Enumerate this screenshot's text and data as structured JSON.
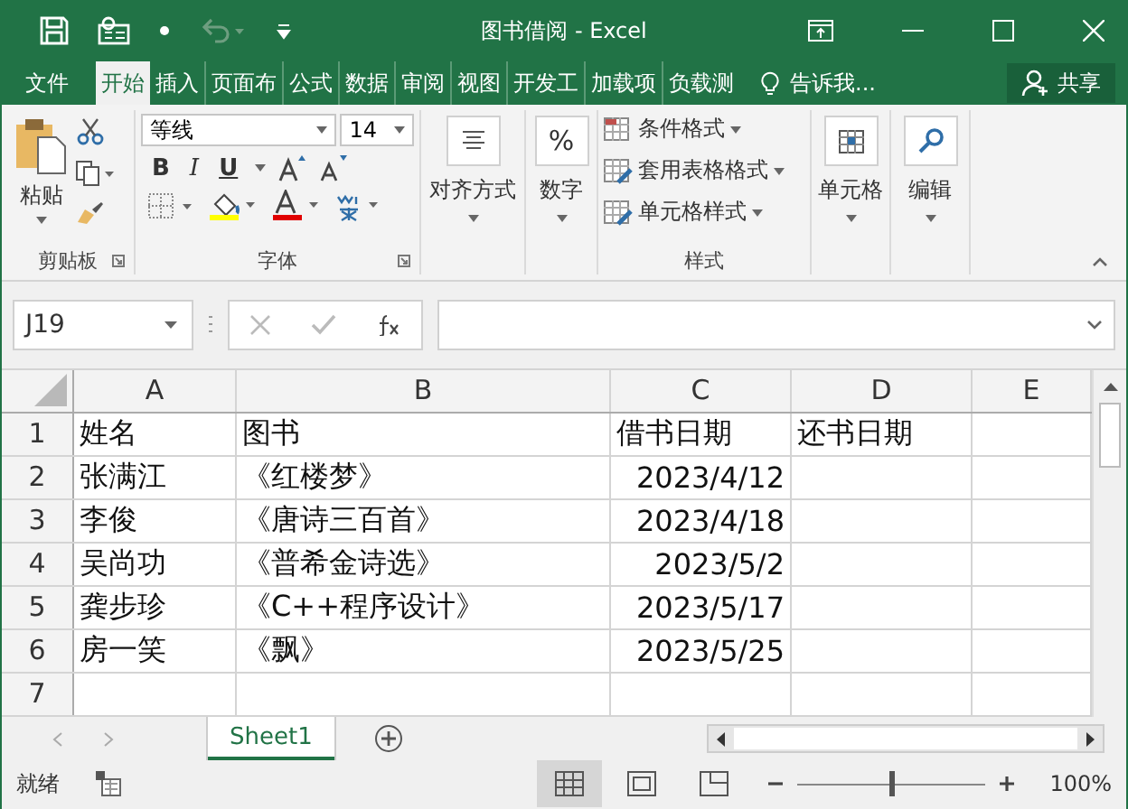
{
  "window": {
    "title": "图书借阅 - Excel"
  },
  "menu_tabs": [
    {
      "label": "文件",
      "selected": false
    },
    {
      "label": "开始",
      "selected": true
    },
    {
      "label": "插入",
      "selected": false
    },
    {
      "label": "页面布",
      "selected": false
    },
    {
      "label": "公式",
      "selected": false
    },
    {
      "label": "数据",
      "selected": false
    },
    {
      "label": "审阅",
      "selected": false
    },
    {
      "label": "视图",
      "selected": false
    },
    {
      "label": "开发工",
      "selected": false
    },
    {
      "label": "加载项",
      "selected": false
    },
    {
      "label": "负载测",
      "selected": false
    }
  ],
  "tell_me": "告诉我...",
  "share": "共享",
  "ribbon": {
    "clipboard": {
      "paste": "粘贴",
      "label": "剪贴板"
    },
    "font": {
      "font_name": "等线",
      "font_size": "14",
      "bold": "B",
      "italic": "I",
      "underline": "U",
      "label": "字体"
    },
    "alignment": {
      "label": "对齐方式"
    },
    "number": {
      "symbol": "%",
      "label": "数字"
    },
    "styles": {
      "items": [
        "条件格式",
        "套用表格格式",
        "单元格样式"
      ],
      "label": "样式"
    },
    "cells": {
      "label": "单元格"
    },
    "editing": {
      "label": "编辑"
    }
  },
  "name_box": "J19",
  "columns": [
    "A",
    "B",
    "C",
    "D",
    "E"
  ],
  "rows": [
    {
      "header": "1",
      "cells": [
        {
          "text": "姓名",
          "kind": "text"
        },
        {
          "text": "图书",
          "kind": "text"
        },
        {
          "text": "借书日期",
          "kind": "text"
        },
        {
          "text": "还书日期",
          "kind": "text"
        }
      ]
    },
    {
      "header": "2",
      "cells": [
        {
          "text": "张满江",
          "kind": "text"
        },
        {
          "text": "《红楼梦》",
          "kind": "text"
        },
        {
          "text": "2023/4/12",
          "kind": "date"
        }
      ]
    },
    {
      "header": "3",
      "cells": [
        {
          "text": "李俊",
          "kind": "text"
        },
        {
          "text": "《唐诗三百首》",
          "kind": "text"
        },
        {
          "text": "2023/4/18",
          "kind": "date"
        }
      ]
    },
    {
      "header": "4",
      "cells": [
        {
          "text": "吴尚功",
          "kind": "text"
        },
        {
          "text": "《普希金诗选》",
          "kind": "text"
        },
        {
          "text": "2023/5/2",
          "kind": "date"
        }
      ]
    },
    {
      "header": "5",
      "cells": [
        {
          "text": "龚步珍",
          "kind": "text"
        },
        {
          "text": "《C++程序设计》",
          "kind": "text"
        },
        {
          "text": "2023/5/17",
          "kind": "date"
        }
      ]
    },
    {
      "header": "6",
      "cells": [
        {
          "text": "房一笑",
          "kind": "text"
        },
        {
          "text": "《飘》",
          "kind": "text"
        },
        {
          "text": "2023/5/25",
          "kind": "date"
        }
      ]
    },
    {
      "header": "7",
      "cells": []
    }
  ],
  "sheet_tabs": [
    {
      "label": "Sheet1",
      "selected": true
    }
  ],
  "status_bar": {
    "status": "就绪",
    "zoom": {
      "level": 0.5,
      "reading": "100%"
    }
  }
}
